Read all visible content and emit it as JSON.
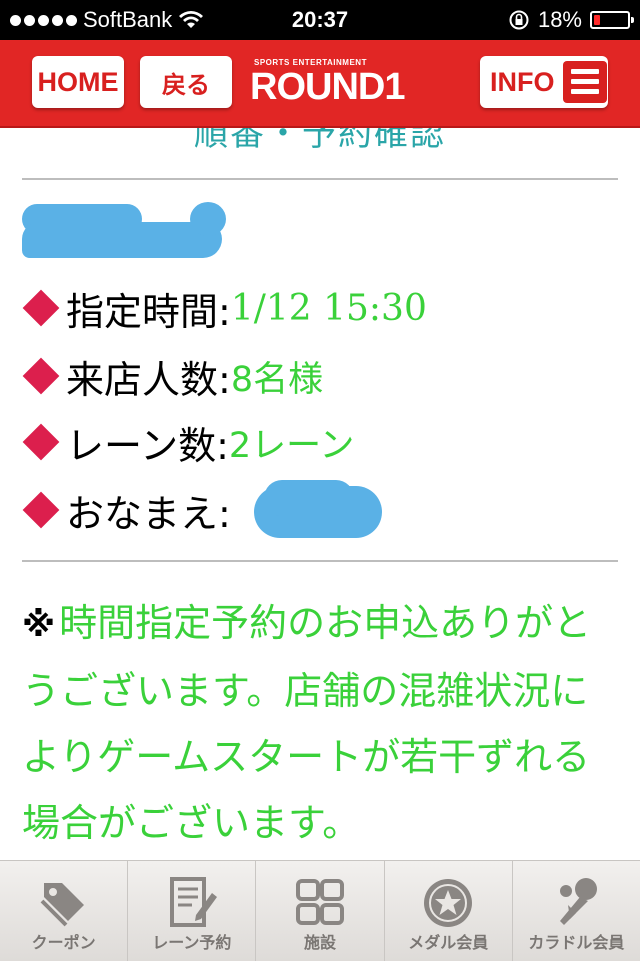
{
  "status_bar": {
    "carrier": "SoftBank",
    "time": "20:37",
    "battery_percent": "18%",
    "battery_level": 0.18,
    "icons": [
      "signal-dots-icon",
      "wifi-icon",
      "rotation-lock-icon",
      "battery-icon"
    ]
  },
  "header": {
    "home_label": "HOME",
    "back_label": "戻る",
    "logo_tagline": "SPORTS ENTERTAINMENT",
    "logo_text": "ROUND1",
    "info_label": "INFO",
    "brand_color": "#e12625"
  },
  "page": {
    "title": "順番・予約確認"
  },
  "details": {
    "time_label": "指定時間:",
    "time_value": "1/12 15:30",
    "people_label": "来店人数:",
    "people_value": "8名様",
    "lanes_label": "レーン数:",
    "lanes_value": "2レーン",
    "name_label": "おなまえ:",
    "accent_color": "#3ad13a",
    "bullet_color": "#dc1f4d"
  },
  "notice": {
    "mark": "※",
    "text": "時間指定予約のお申込ありがとうございます。店舗の混雑状況によりゲームスタートが若干ずれる場合がございます。"
  },
  "tabs": [
    {
      "label": "クーポン",
      "icon": "coupon-tag-icon"
    },
    {
      "label": "レーン予約",
      "icon": "reservation-form-icon"
    },
    {
      "label": "施設",
      "icon": "facility-grid-icon"
    },
    {
      "label": "メダル会員",
      "icon": "medal-icon"
    },
    {
      "label": "カラドル会員",
      "icon": "karaoke-mic-icon"
    }
  ]
}
